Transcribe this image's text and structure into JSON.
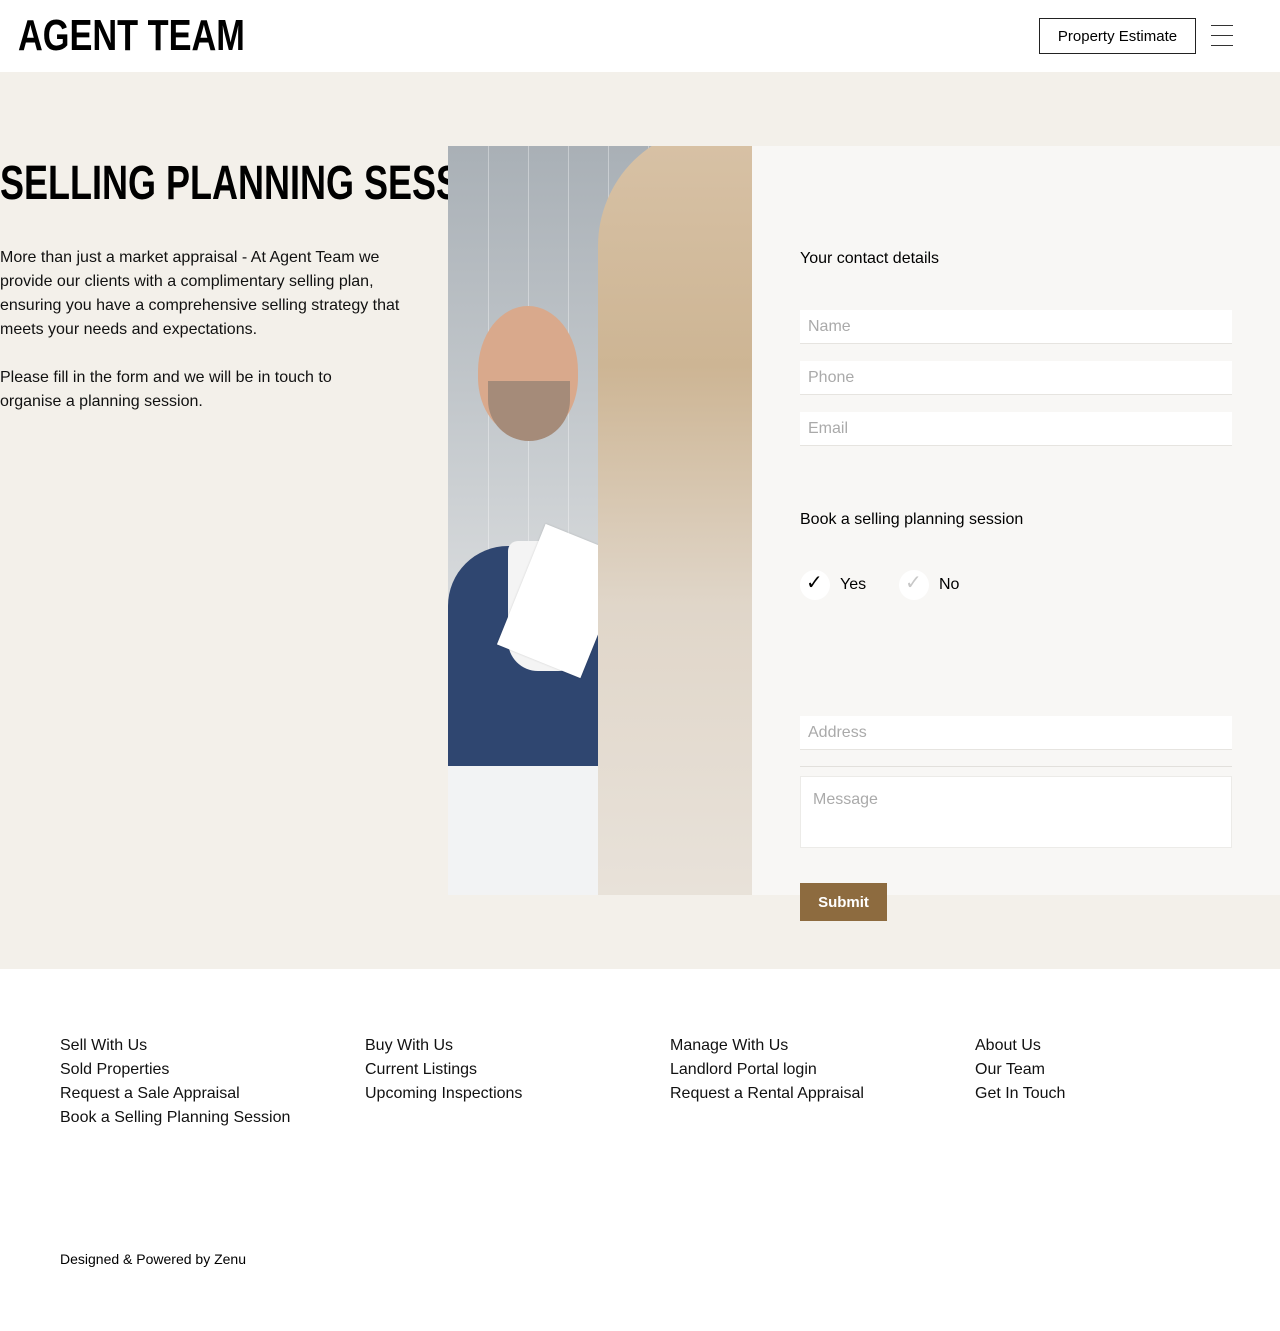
{
  "header": {
    "logo": "AGENT TEAM",
    "estimate_label": "Property Estimate",
    "menu_icon": "hamburger-menu-icon"
  },
  "hero": {
    "title": "SELLING PLANNING SESSION",
    "paragraph1": "More than just a market appraisal - At Agent Team we provide our clients with a complimentary selling plan, ensuring you have a comprehensive selling strategy that meets your needs and expectations.",
    "paragraph2": "Please fill in the form and we will be in touch to organise a planning session.",
    "background": "#f3f0ea"
  },
  "form": {
    "contact_heading": "Your contact details",
    "name_placeholder": "Name",
    "phone_placeholder": "Phone",
    "email_placeholder": "Email",
    "booking_heading": "Book a selling planning session",
    "options": [
      {
        "label": "Yes",
        "checked": true
      },
      {
        "label": "No",
        "checked": false
      }
    ],
    "address_placeholder": "Address",
    "message_placeholder": "Message",
    "submit_label": "Submit",
    "submit_color": "#8d6b3f"
  },
  "footer": {
    "columns": [
      [
        "Sell With Us",
        "Sold Properties",
        "Request a Sale Appraisal",
        "Book a Selling Planning Session"
      ],
      [
        "Buy With Us",
        "Current Listings",
        "Upcoming Inspections"
      ],
      [
        "Manage With Us",
        "Landlord Portal login",
        "Request a Rental Appraisal"
      ],
      [
        "About Us",
        "Our Team",
        "Get In Touch"
      ]
    ],
    "credit": "Designed & Powered by Zenu"
  }
}
